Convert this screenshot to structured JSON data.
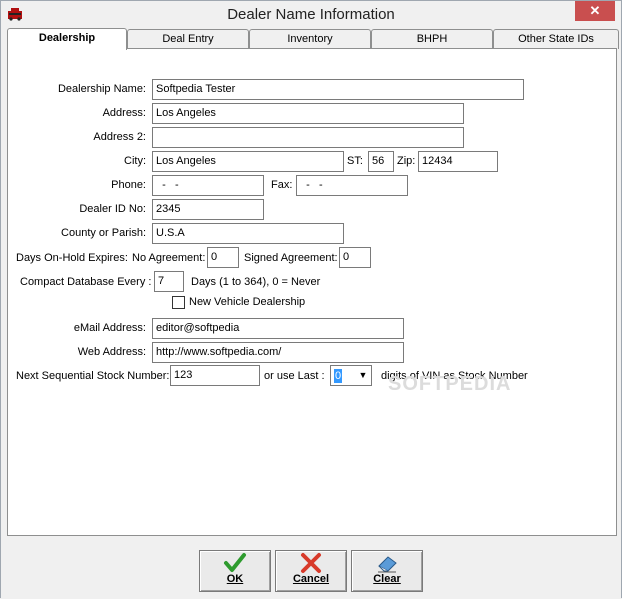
{
  "window": {
    "title": "Dealer Name Information",
    "close_glyph": "✕",
    "app_icon": "app-logo-icon"
  },
  "tabs": [
    {
      "label": "Dealership"
    },
    {
      "label": "Deal Entry"
    },
    {
      "label": "Inventory"
    },
    {
      "label": "BHPH"
    },
    {
      "label": "Other State IDs"
    }
  ],
  "form": {
    "dealership_name": {
      "label": "Dealership Name:",
      "value": "Softpedia Tester"
    },
    "address": {
      "label": "Address:",
      "value": "Los Angeles"
    },
    "address2": {
      "label": "Address 2:",
      "value": ""
    },
    "city": {
      "label": "City:",
      "value": "Los Angeles"
    },
    "st": {
      "label": "ST:",
      "value": "56"
    },
    "zip": {
      "label": "Zip:",
      "value": "12434"
    },
    "phone": {
      "label": "Phone:",
      "value": "  -   -"
    },
    "fax": {
      "label": "Fax:",
      "value": "  -   -"
    },
    "dealer_id": {
      "label": "Dealer ID No:",
      "value": "2345"
    },
    "county": {
      "label": "County or Parish:",
      "value": "U.S.A"
    },
    "days_onhold": {
      "label": "Days On-Hold Expires:"
    },
    "no_agreement": {
      "label": "No Agreement:",
      "value": "0"
    },
    "signed_agreement": {
      "label": "Signed Agreement:",
      "value": "0"
    },
    "compact": {
      "label": "Compact Database Every :",
      "value": "7",
      "hint": "Days (1 to 364), 0 = Never"
    },
    "new_vehicle": {
      "label": "New Vehicle Dealership",
      "checked": false
    },
    "email": {
      "label": "eMail Address:",
      "value": "editor@softpedia"
    },
    "web": {
      "label": "Web Address:",
      "value": "http://www.softpedia.com/"
    },
    "stock": {
      "label": "Next Sequential Stock Number:",
      "value": "123",
      "or_label": "or use Last :",
      "last_value": "0",
      "suffix": "digits of VIN as Stock Number"
    }
  },
  "watermark": "SOFTPEDIA",
  "buttons": {
    "ok": {
      "label": "OK",
      "icon": "checkmark-icon"
    },
    "cancel": {
      "label": "Cancel",
      "icon": "x-icon"
    },
    "clear": {
      "label": "Clear",
      "icon": "eraser-icon"
    }
  },
  "colors": {
    "ok_green": "#2e9b2e",
    "cancel_red": "#d83a2a",
    "selection_blue": "#3399ff"
  }
}
